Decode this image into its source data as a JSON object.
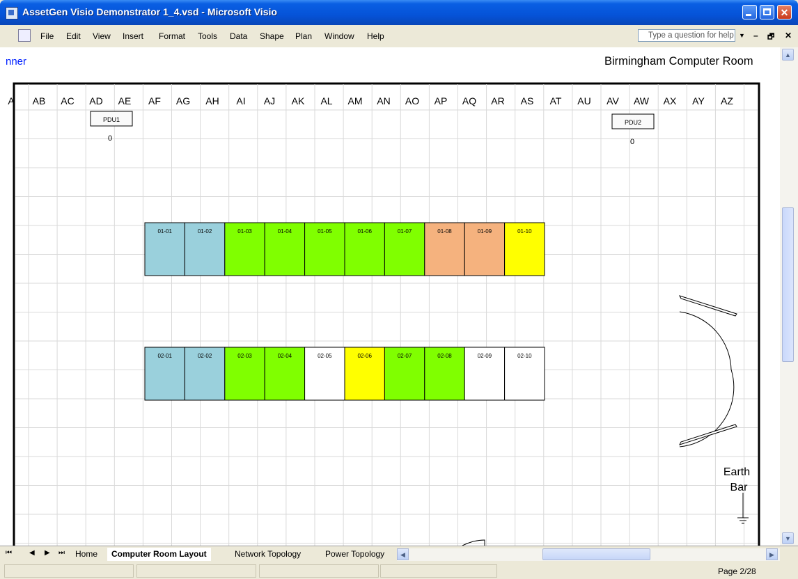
{
  "window": {
    "title": "AssetGen Visio Demonstrator 1_4.vsd - Microsoft Visio",
    "controls": {
      "minimize": "minimize",
      "maximize": "maximize",
      "close": "✕"
    }
  },
  "menu": {
    "items": [
      "File",
      "Edit",
      "View",
      "Insert",
      "Format",
      "Tools",
      "Data",
      "Shape",
      "Plan",
      "Window",
      "Help"
    ],
    "help_placeholder": "Type a question for help",
    "mdi": {
      "minimize": "–",
      "restore": "🗗",
      "close": "✕"
    }
  },
  "canvas": {
    "header_left": "nner",
    "header_right": "Birmingham Computer Room",
    "columns": [
      "A",
      "AB",
      "AC",
      "AD",
      "AE",
      "AF",
      "AG",
      "AH",
      "AI",
      "AJ",
      "AK",
      "AL",
      "AM",
      "AN",
      "AO",
      "AP",
      "AQ",
      "AR",
      "AS",
      "AT",
      "AU",
      "AV",
      "AW",
      "AX",
      "AY",
      "AZ"
    ],
    "pdus": [
      {
        "label": "PDU1",
        "value": "0"
      },
      {
        "label": "PDU2",
        "value": "0"
      }
    ],
    "rack_rows": [
      {
        "racks": [
          {
            "label": "01-01",
            "color": "#9ad0dc"
          },
          {
            "label": "01-02",
            "color": "#9ad0dc"
          },
          {
            "label": "01-03",
            "color": "#80ff00"
          },
          {
            "label": "01-04",
            "color": "#80ff00"
          },
          {
            "label": "01-05",
            "color": "#80ff00"
          },
          {
            "label": "01-06",
            "color": "#80ff00"
          },
          {
            "label": "01-07",
            "color": "#80ff00"
          },
          {
            "label": "01-08",
            "color": "#f5b27e"
          },
          {
            "label": "01-09",
            "color": "#f5b27e"
          },
          {
            "label": "01-10",
            "color": "#ffff00"
          }
        ]
      },
      {
        "racks": [
          {
            "label": "02-01",
            "color": "#9ad0dc"
          },
          {
            "label": "02-02",
            "color": "#9ad0dc"
          },
          {
            "label": "02-03",
            "color": "#80ff00"
          },
          {
            "label": "02-04",
            "color": "#80ff00"
          },
          {
            "label": "02-05",
            "color": "#ffffff"
          },
          {
            "label": "02-06",
            "color": "#ffff00"
          },
          {
            "label": "02-07",
            "color": "#80ff00"
          },
          {
            "label": "02-08",
            "color": "#80ff00"
          },
          {
            "label": "02-09",
            "color": "#ffffff"
          },
          {
            "label": "02-10",
            "color": "#ffffff"
          }
        ]
      }
    ],
    "earth_bar": {
      "line1": "Earth",
      "line2": "Bar"
    }
  },
  "sheet_tabs": {
    "nav": [
      "⏮",
      "◀",
      "▶",
      "⏭"
    ],
    "tabs": [
      {
        "label": "Home",
        "active": false
      },
      {
        "label": "Computer Room Layout",
        "active": true
      },
      {
        "label": "Network Topology",
        "active": false
      },
      {
        "label": "Power Topology",
        "active": false
      }
    ]
  },
  "status": {
    "page": "Page 2/28"
  }
}
